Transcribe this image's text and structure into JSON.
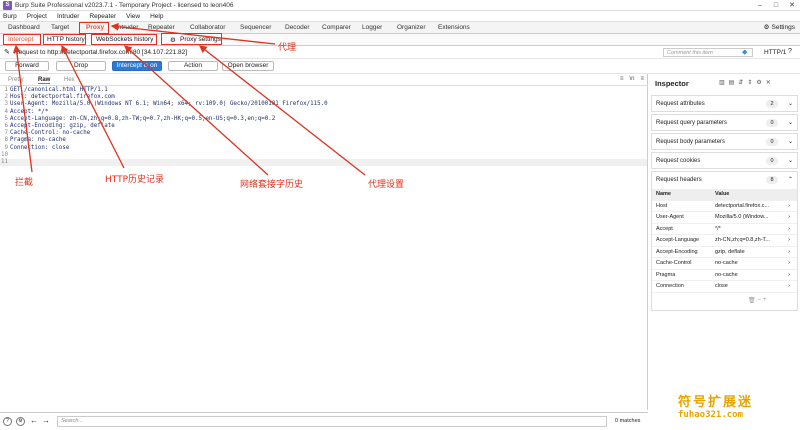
{
  "window": {
    "title": "Burp Suite Professional v2023.7.1 - Temporary Project - licensed to leon406",
    "logo": "S"
  },
  "menu": [
    "Burp",
    "Project",
    "Intruder",
    "Repeater",
    "View",
    "Help"
  ],
  "main_tabs": [
    "Dashboard",
    "Target",
    "Proxy",
    "Intruder",
    "Repeater",
    "Collaborator",
    "Sequencer",
    "Decoder",
    "Comparer",
    "Logger",
    "Organizer",
    "Extensions"
  ],
  "settings_label": "Settings",
  "proxy_tabs": [
    "Intercept",
    "HTTP history",
    "WebSockets history",
    "Proxy settings"
  ],
  "request_to": "Request to http://detectportal.firefox.com:80  [34.107.221.82]",
  "comment_placeholder": "Comment this item",
  "http_version": "HTTP/1",
  "toolbar": {
    "forward": "Forward",
    "drop": "Drop",
    "intercept": "Intercept is on",
    "action": "Action",
    "open_browser": "Open browser"
  },
  "editor_tabs": [
    "Pretty",
    "Raw",
    "Hex"
  ],
  "editor_icons": {
    "wrap": "≡",
    "newline": "\\n",
    "menu": "≡"
  },
  "request_lines": [
    "GET /canonical.html HTTP/1.1",
    "Host: detectportal.firefox.com",
    "User-Agent: Mozilla/5.0 (Windows NT 6.1; Win64; x64; rv:109.0) Gecko/20100101 Firefox/115.0",
    "Accept: */*",
    "Accept-Language: zh-CN,zh;q=0.8,zh-TW;q=0.7,zh-HK;q=0.5,en-US;q=0.3,en;q=0.2",
    "Accept-Encoding: gzip, deflate",
    "Cache-Control: no-cache",
    "Pragma: no-cache",
    "Connection: close",
    "",
    ""
  ],
  "inspector": {
    "title": "Inspector",
    "sections": [
      {
        "label": "Request attributes",
        "count": "2"
      },
      {
        "label": "Request query parameters",
        "count": "0"
      },
      {
        "label": "Request body parameters",
        "count": "0"
      },
      {
        "label": "Request cookies",
        "count": "0"
      },
      {
        "label": "Request headers",
        "count": "8"
      }
    ],
    "header_cols": [
      "Name",
      "Value"
    ],
    "headers": [
      {
        "name": "Host",
        "value": "detectportal.firefox.c..."
      },
      {
        "name": "User-Agent",
        "value": "Mozilla/5.0 (Window..."
      },
      {
        "name": "Accept",
        "value": "*/*"
      },
      {
        "name": "Accept-Language",
        "value": "zh-CN,zh;q=0.8,zh-T..."
      },
      {
        "name": "Accept-Encoding",
        "value": "gzip, deflate"
      },
      {
        "name": "Cache-Control",
        "value": "no-cache"
      },
      {
        "name": "Pragma",
        "value": "no-cache"
      },
      {
        "name": "Connection",
        "value": "close"
      }
    ]
  },
  "search_placeholder": "Search...",
  "matches": "0 matches",
  "annotations": {
    "proxy": "代理",
    "intercept": "拦截",
    "http_history": "HTTP历史记录",
    "websockets": "网络套接字历史",
    "proxy_settings": "代理设置"
  },
  "watermark": {
    "cn": "符号扩展迷",
    "en": "fuhao321.com"
  },
  "colors": {
    "annotation": "#e0321c",
    "intercept_button": "#2a7bd8",
    "proxy_tab": "#e8572c",
    "watermark": "#e8a400"
  }
}
